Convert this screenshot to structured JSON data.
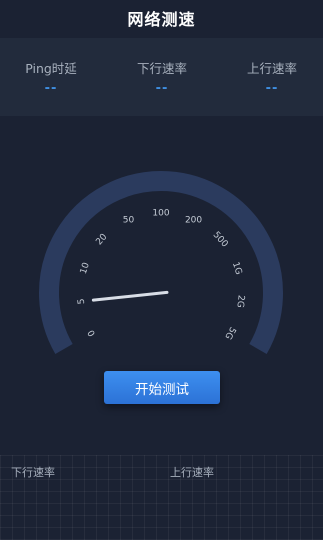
{
  "header": {
    "title": "网络测速"
  },
  "stats": [
    {
      "label": "Ping时延",
      "value": "--"
    },
    {
      "label": "下行速率",
      "value": "--"
    },
    {
      "label": "上行速率",
      "value": "--"
    }
  ],
  "gauge": {
    "ticks": [
      "0",
      "5",
      "10",
      "20",
      "50",
      "100",
      "200",
      "500",
      "1G",
      "2G",
      "5G"
    ],
    "needle_fraction": 0.1,
    "colors": {
      "arc": "#2b3b5e",
      "needle": "#d8dde6"
    }
  },
  "actions": {
    "start_label": "开始测试"
  },
  "chart": {
    "left_label": "下行速率",
    "right_label": "上行速率"
  }
}
